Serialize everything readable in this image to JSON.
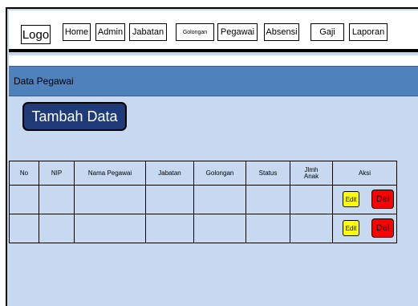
{
  "nav": {
    "logo": "Logo",
    "items": [
      "Home",
      "Admin",
      "Jabatan",
      "Golongan",
      "Pegawai",
      "Absensi",
      "Gaji",
      "Laporan"
    ]
  },
  "header": {
    "title": "Data Pegawai"
  },
  "add_button": "Tambah Data",
  "table": {
    "columns": [
      "No",
      "NIP",
      "Nama Pegawai",
      "Jabatan",
      "Golongan",
      "Status",
      "Jlmh Anak",
      "Aksi"
    ],
    "rows": [
      {
        "edit": "Edit",
        "delete": "Del"
      },
      {
        "edit": "Edit",
        "delete": "Del"
      }
    ]
  },
  "colors": {
    "header_bg": "#4f81bd",
    "add_button_bg": "#1f3a78",
    "page_bg": "#c6d9f0",
    "edit": "#ffff00",
    "delete": "#ff0000"
  }
}
